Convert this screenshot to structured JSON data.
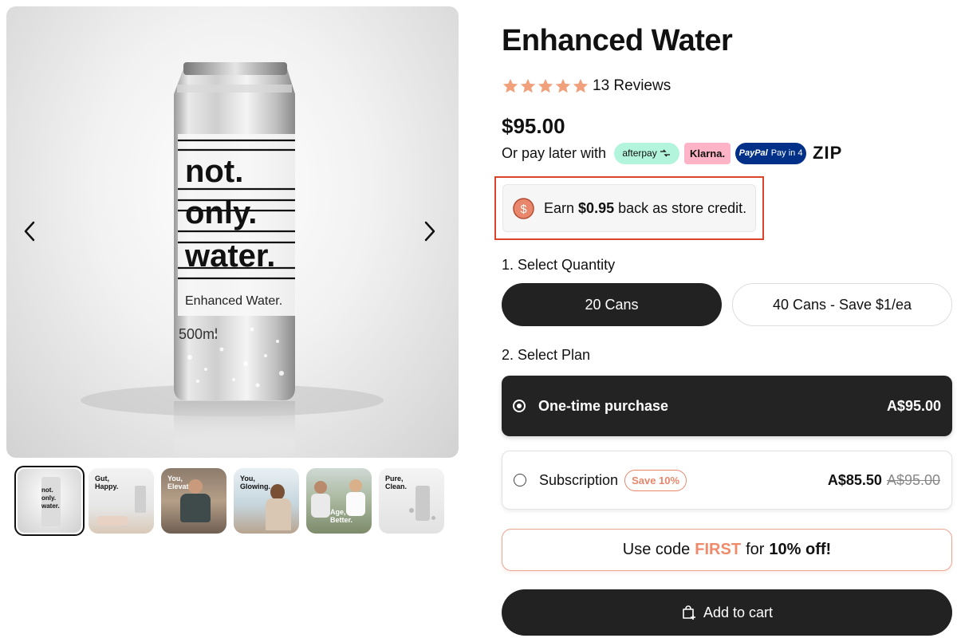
{
  "product": {
    "title": "Enhanced Water",
    "review_count": "13 Reviews",
    "rating": 5,
    "price": "$95.00"
  },
  "pay_later": {
    "text": "Or pay later with",
    "providers": [
      "afterpay",
      "Klarna.",
      "PayPal",
      "Pay in 4",
      "ZIP"
    ]
  },
  "store_credit": {
    "prefix": "Earn",
    "amount": "$0.95",
    "suffix": "back as store credit."
  },
  "quantity": {
    "label": "1. Select Quantity",
    "options": [
      "20 Cans",
      "40 Cans - Save $1/ea"
    ],
    "selected": "20 Cans"
  },
  "plan": {
    "label": "2. Select Plan",
    "one_time": {
      "name": "One-time purchase",
      "price": "A$95.00"
    },
    "subscription": {
      "name": "Subscription",
      "badge": "Save 10%",
      "price": "A$85.50",
      "old_price": "A$95.00"
    },
    "selected": "One-time purchase"
  },
  "promo": {
    "prefix": "Use code",
    "code": "FIRST",
    "middle": "for",
    "suffix": "10% off!"
  },
  "cart": {
    "label": "Add to cart"
  },
  "can": {
    "line1": "not.",
    "line2": "only.",
    "line3": "water.",
    "subtitle": "Enhanced Water.",
    "volume": "500ml"
  },
  "thumbnails": [
    {
      "lines": [
        "not.",
        "only.",
        "water."
      ]
    },
    {
      "lines": [
        "Gut,",
        "Happy."
      ]
    },
    {
      "lines": [
        "You,",
        "Elevated."
      ]
    },
    {
      "lines": [
        "You,",
        "Glowing."
      ]
    },
    {
      "lines": [
        "Age,",
        "Better."
      ]
    },
    {
      "lines": [
        "Pure,",
        "Clean."
      ]
    }
  ],
  "colors": {
    "accent": "#f08a6a",
    "highlight_border": "#d9442b",
    "dark_button": "#222222",
    "star": "#f0a07a"
  }
}
